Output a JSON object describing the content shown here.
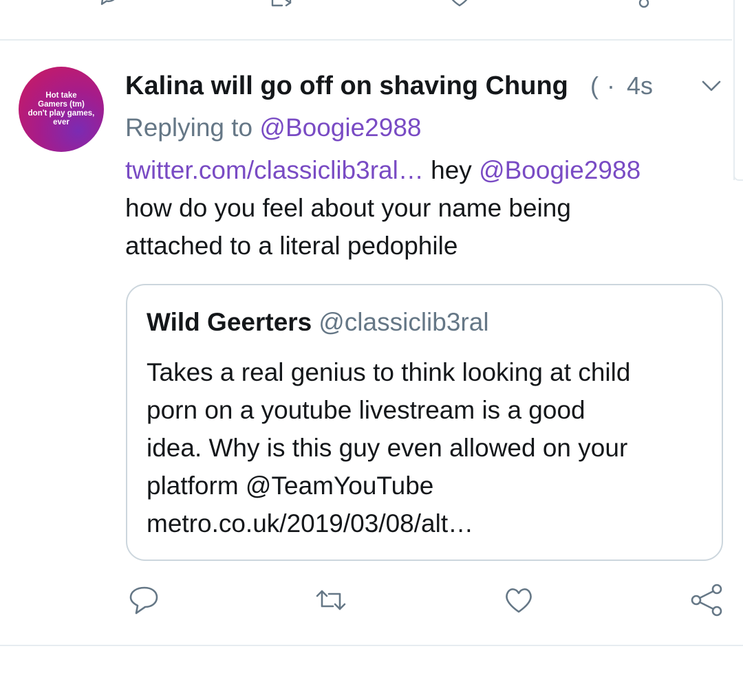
{
  "tweet": {
    "avatar_text": [
      "Hot take",
      "Gamers (tm)",
      "don't play games,",
      "ever"
    ],
    "display_name": "Kalina will go off on shaving Chung",
    "handle_partial": "(",
    "separator": "·",
    "timestamp": "4s",
    "replying_label": "Replying to",
    "replying_handle": "@Boogie2988",
    "text_link": "twitter.com/classiclib3ral…",
    "text_part1": " hey ",
    "text_mention": "@Boogie2988",
    "text_line2": "how do you feel about your name being",
    "text_line3": "attached to a literal pedophile"
  },
  "quoted_tweet": {
    "display_name": "Wild Geerters",
    "handle": "@classiclib3ral",
    "lines": [
      "Takes a real genius to think looking at child",
      "porn on a youtube livestream is a good",
      "idea. Why is this guy even allowed on your",
      "platform @TeamYouTube",
      "metro.co.uk/2019/03/08/alt…"
    ]
  },
  "icons": {
    "reply": "reply-icon",
    "retweet": "retweet-icon",
    "like": "like-icon",
    "share": "share-icon",
    "more": "chevron-down-icon"
  },
  "colors": {
    "link": "#794bc4",
    "secondary_text": "#657786",
    "primary_text": "#14171a",
    "border": "#ccd6dd",
    "divider": "#e6ecf0"
  }
}
